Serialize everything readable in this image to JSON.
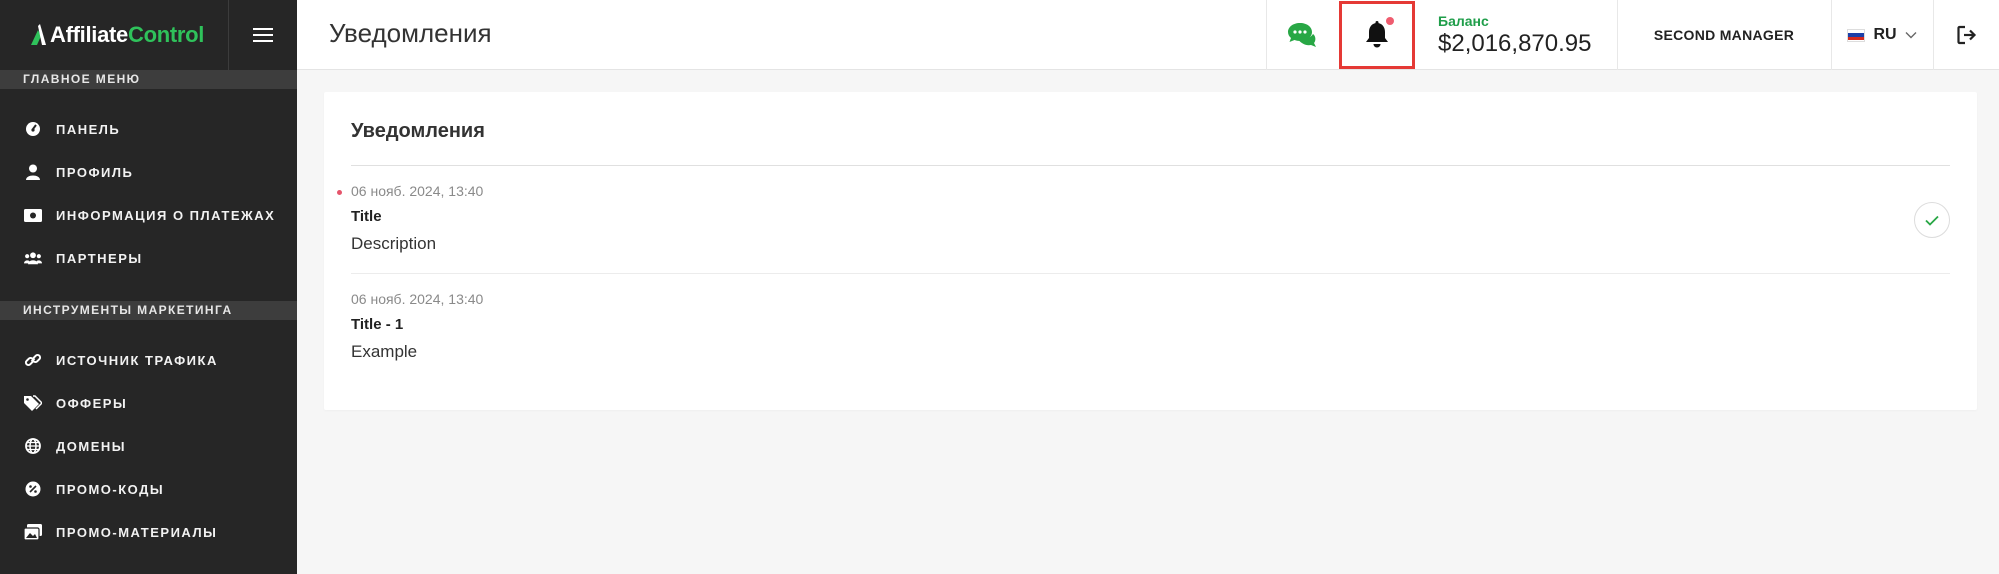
{
  "brand": {
    "logo_part1": "Affiliate",
    "logo_part2": "Control",
    "accent_color": "#2fc25b"
  },
  "sidebar": {
    "section_main": "ГЛАВНОЕ МЕНЮ",
    "main_items": [
      {
        "label": "ПАНЕЛЬ",
        "icon": "gauge-icon"
      },
      {
        "label": "ПРОФИЛЬ",
        "icon": "user-icon"
      },
      {
        "label": "ИНФОРМАЦИЯ О ПЛАТЕЖАХ",
        "icon": "money-icon"
      },
      {
        "label": "ПАРТНЕРЫ",
        "icon": "users-icon"
      }
    ],
    "section_marketing": "ИНСТРУМЕНТЫ МАРКЕТИНГА",
    "marketing_items": [
      {
        "label": "ИСТОЧНИК ТРАФИКА",
        "icon": "link-icon"
      },
      {
        "label": "ОФФЕРЫ",
        "icon": "tags-icon"
      },
      {
        "label": "ДОМЕНЫ",
        "icon": "globe-icon"
      },
      {
        "label": "ПРОМО-КОДЫ",
        "icon": "percent-icon"
      },
      {
        "label": "ПРОМО-МАТЕРИАЛЫ",
        "icon": "images-icon"
      }
    ]
  },
  "header": {
    "page_title": "Уведомления",
    "balance_label": "Баланс",
    "balance_value": "$2,016,870.95",
    "user_name": "SECOND MANAGER",
    "language": "RU",
    "chat_color": "#28a745",
    "notification_dot_color": "#ef5c6f"
  },
  "notifications": {
    "card_title": "Уведомления",
    "items": [
      {
        "date": "06 нояб. 2024, 13:40",
        "title": "Title",
        "description": "Description",
        "unread": true
      },
      {
        "date": "06 нояб. 2024, 13:40",
        "title": "Title - 1",
        "description": "Example",
        "unread": false
      }
    ]
  }
}
